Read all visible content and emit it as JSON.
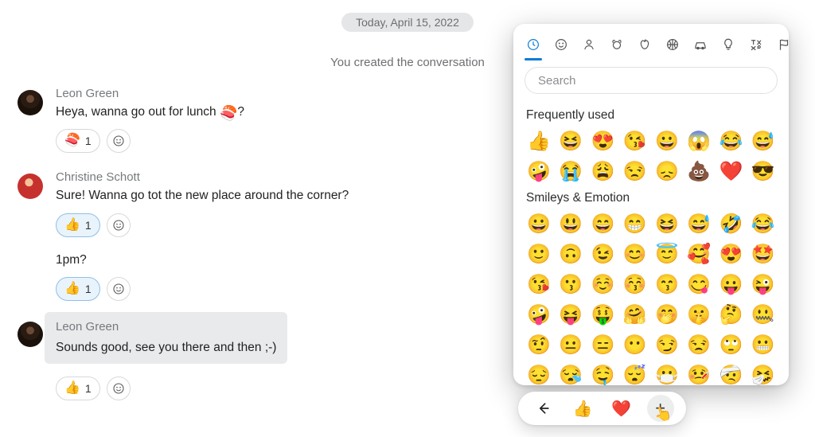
{
  "date_chip": "Today, April 15, 2022",
  "system_message": "You created the conversation",
  "messages": [
    {
      "sender": "Leon Green",
      "avatar": "dark",
      "lines": [
        {
          "text_before": "Heya, wanna go out for lunch ",
          "emoji": "🍣",
          "text_after": "?",
          "highlight": false,
          "reactions": {
            "emoji": "🍣",
            "count": "1",
            "selected": false
          }
        }
      ]
    },
    {
      "sender": "Christine Schott",
      "avatar": "red",
      "lines": [
        {
          "text_before": "Sure! Wanna go tot the new place around the corner?",
          "emoji": "",
          "text_after": "",
          "highlight": false,
          "reactions": {
            "emoji": "👍",
            "count": "1",
            "selected": true
          }
        },
        {
          "text_before": "1pm?",
          "emoji": "",
          "text_after": "",
          "highlight": false,
          "reactions": {
            "emoji": "👍",
            "count": "1",
            "selected": true
          }
        }
      ]
    },
    {
      "sender": "Leon Green",
      "avatar": "dark",
      "lines": [
        {
          "text_before": "Sounds good, see you there and then ;-)",
          "emoji": "",
          "text_after": "",
          "highlight": true,
          "reactions": {
            "emoji": "👍",
            "count": "1",
            "selected": false
          }
        }
      ]
    }
  ],
  "picker": {
    "tabs": [
      "recent",
      "smiley",
      "body",
      "animal",
      "food",
      "activity",
      "travel",
      "object",
      "symbol",
      "flag"
    ],
    "search_placeholder": "Search",
    "sections": {
      "frequent_title": "Frequently used",
      "frequent": [
        "👍",
        "😆",
        "😍",
        "😘",
        "😀",
        "😱",
        "😂",
        "😅",
        "🤪",
        "😭",
        "😩",
        "😒",
        "😞",
        "💩",
        "❤️",
        "😎"
      ],
      "smileys_title": "Smileys & Emotion",
      "smileys": [
        "😀",
        "😃",
        "😄",
        "😁",
        "😆",
        "😅",
        "🤣",
        "😂",
        "🙂",
        "🙃",
        "😉",
        "😊",
        "😇",
        "🥰",
        "😍",
        "🤩",
        "😘",
        "😗",
        "☺️",
        "😚",
        "😙",
        "😋",
        "😛",
        "😜",
        "🤪",
        "😝",
        "🤑",
        "🤗",
        "🤭",
        "🤫",
        "🤔",
        "🤐",
        "🤨",
        "😐",
        "😑",
        "😶",
        "😏",
        "😒",
        "🙄",
        "😬",
        "😔",
        "😪",
        "🤤",
        "😴",
        "😷",
        "🤒",
        "🤕",
        "🤧"
      ]
    }
  },
  "quickbar": {
    "back": "←",
    "thumb": "👍",
    "heart": "❤️",
    "more": "+"
  }
}
